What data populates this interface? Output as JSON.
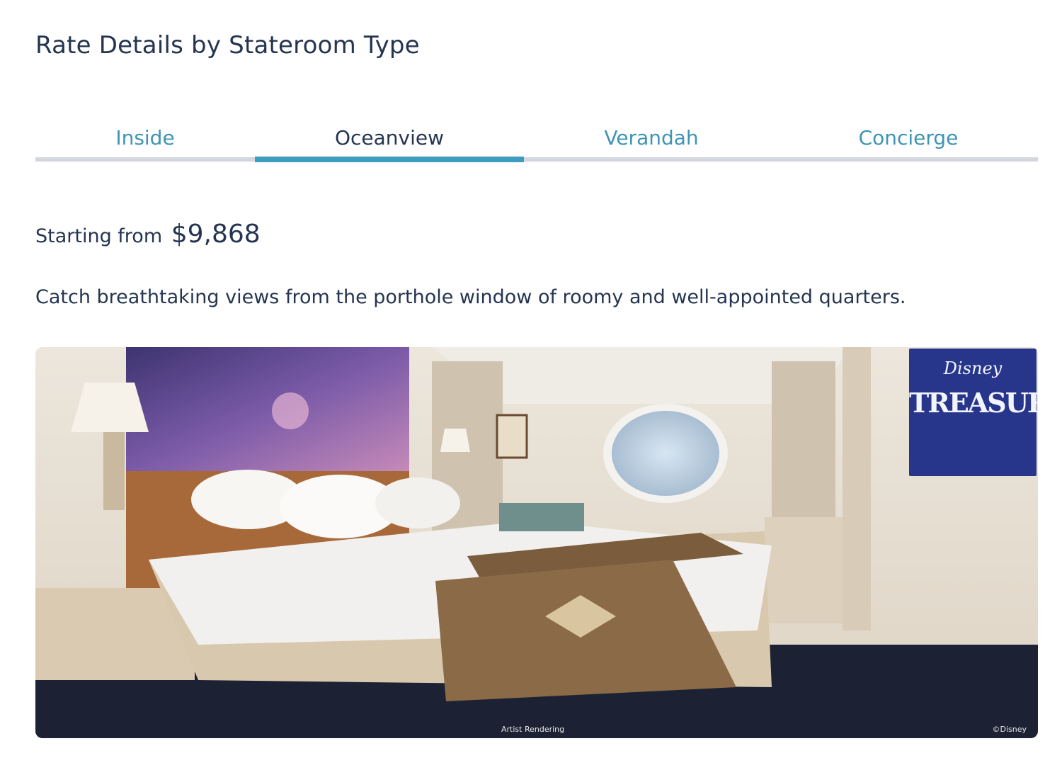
{
  "heading": "Rate Details by Stateroom Type",
  "tabs": [
    {
      "label": "Inside",
      "active": false
    },
    {
      "label": "Oceanview",
      "active": true
    },
    {
      "label": "Verandah",
      "active": false
    },
    {
      "label": "Concierge",
      "active": false
    }
  ],
  "price": {
    "prefix": "Starting from",
    "value": "$9,868"
  },
  "description": "Catch breathtaking views from the porthole window of roomy and well-appointed quarters.",
  "image": {
    "tv_logo_line1": "Disney",
    "tv_logo_line2": "TREASURE",
    "caption_artist": "Artist Rendering",
    "caption_copyright": "©Disney"
  },
  "colors": {
    "heading_text": "#253551",
    "tab_inactive": "#3e94b6",
    "tab_active_underline": "#3e9cbf",
    "tab_track": "#d3d6dc"
  }
}
